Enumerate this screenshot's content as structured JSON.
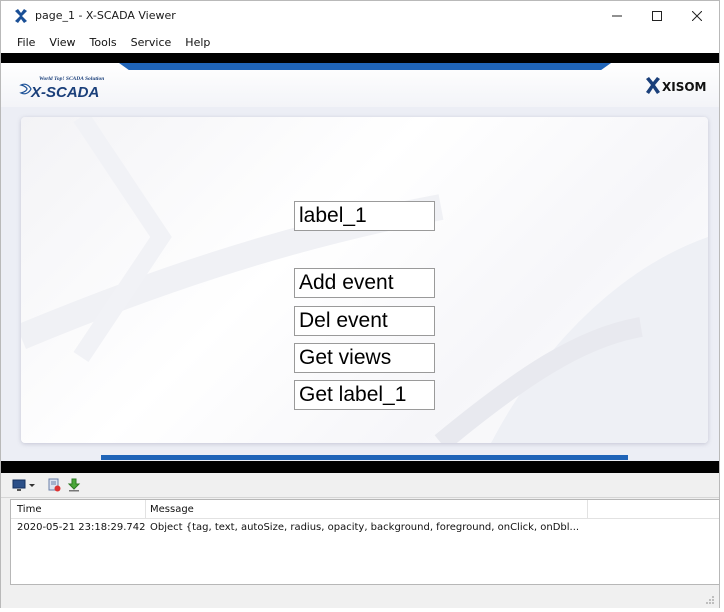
{
  "window": {
    "title": "page_1 - X-SCADA Viewer",
    "controls": {
      "minimize": "—",
      "maximize": "☐",
      "close": "✕"
    }
  },
  "menu": [
    "File",
    "View",
    "Tools",
    "Service",
    "Help"
  ],
  "header": {
    "logo_left": "X-SCADA",
    "logo_left_tagline": "World Top! SCADA Solution",
    "logo_right": "XISOM"
  },
  "canvas": {
    "label": "label_1",
    "buttons": [
      "Add event",
      "Del event",
      "Get views",
      "Get label_1"
    ]
  },
  "log": {
    "columns": {
      "time": "Time",
      "message": "Message"
    },
    "rows": [
      {
        "time": "2020-05-21 23:18:29.742",
        "message": "Object {tag, text, autoSize, radius, opacity, background, foreground, onClick, onDbl..."
      }
    ]
  },
  "colors": {
    "accent_blue": "#1f64b8",
    "frame": "#000000"
  }
}
